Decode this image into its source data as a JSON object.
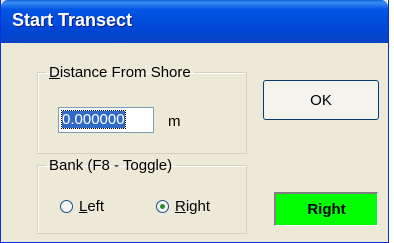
{
  "window": {
    "title": "Start Transect"
  },
  "distance_group": {
    "legend_underlined": "D",
    "legend_rest": "istance From Shore",
    "value": "0.000000",
    "unit": "m"
  },
  "bank_group": {
    "legend": "Bank (F8 - Toggle)",
    "options": [
      {
        "underlined": "L",
        "rest": "eft",
        "selected": false
      },
      {
        "underlined": "R",
        "rest": "ight",
        "selected": true
      }
    ]
  },
  "ok_label": "OK",
  "status": {
    "label": "Right",
    "color": "#00ff00"
  }
}
